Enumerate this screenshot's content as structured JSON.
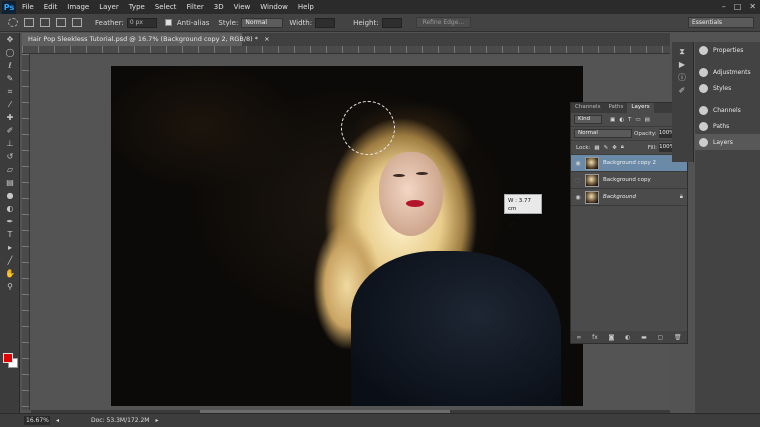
{
  "app": {
    "logo": "Ps"
  },
  "menu": [
    "File",
    "Edit",
    "Image",
    "Layer",
    "Type",
    "Select",
    "Filter",
    "3D",
    "View",
    "Window",
    "Help"
  ],
  "window_controls": [
    "–",
    "□",
    "✕"
  ],
  "options": {
    "feather_label": "Feather:",
    "feather_value": "0 px",
    "antialias_label": "Anti-alias",
    "style_label": "Style:",
    "style_value": "Normal",
    "width_label": "Width:",
    "height_label": "Height:",
    "refine_label": "Refine Edge...",
    "workspace": "Essentials"
  },
  "document": {
    "tab_title": "Hair Pop Sleekless Tutorial.psd @ 16.7% (Background copy 2, RGB/8) *",
    "close": "×"
  },
  "selection_readout": {
    "w": "W :  3.77 cm",
    "h": "H :  4.78 cm"
  },
  "layers_panel": {
    "tabs": [
      "Channels",
      "Paths",
      "Layers"
    ],
    "active_tab": "Layers",
    "filter_kind": "Kind",
    "blend_mode": "Normal",
    "opacity_label": "Opacity:",
    "opacity_value": "100%",
    "lock_label": "Lock:",
    "fill_label": "Fill:",
    "fill_value": "100%",
    "layers": [
      {
        "name": "Background copy 2",
        "visible": true,
        "selected": true
      },
      {
        "name": "Background copy",
        "visible": false,
        "selected": false
      },
      {
        "name": "Background",
        "visible": true,
        "selected": false,
        "locked": true
      }
    ]
  },
  "right_dock": [
    "Properties",
    "Adjustments",
    "Styles",
    "Channels",
    "Paths",
    "Layers"
  ],
  "right_dock_active": "Layers",
  "status": {
    "zoom": "16.67%",
    "doc_size": "Doc: 53.3M/172.2M"
  },
  "colors": {
    "foreground": "#e00000",
    "background": "#ffffff",
    "layer_selected": "#6b8aa8"
  }
}
